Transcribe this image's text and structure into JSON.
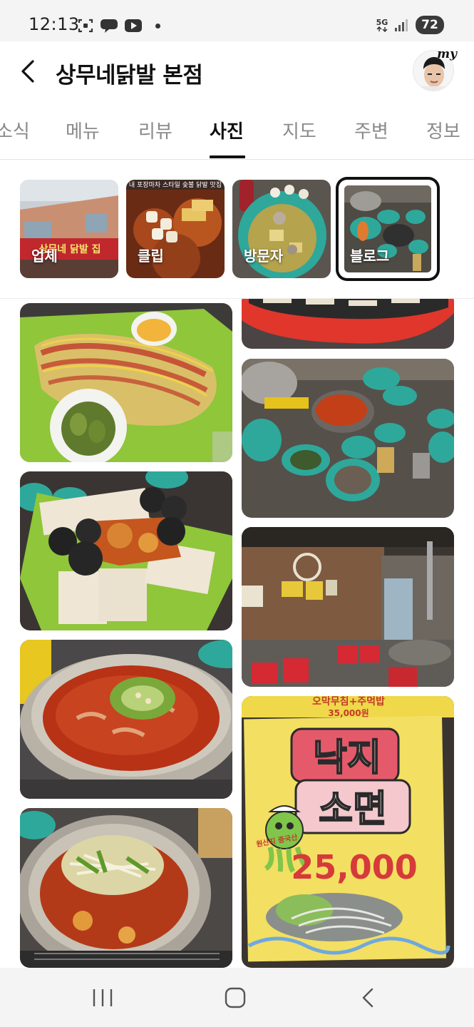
{
  "status_bar": {
    "time": "12:13",
    "network": "5G",
    "battery": "72"
  },
  "header": {
    "title": "상무네닭발 본점",
    "profile_badge": "my"
  },
  "tabs": [
    {
      "label": "소식",
      "active": false
    },
    {
      "label": "메뉴",
      "active": false
    },
    {
      "label": "리뷰",
      "active": false
    },
    {
      "label": "사진",
      "active": true
    },
    {
      "label": "지도",
      "active": false
    },
    {
      "label": "주변",
      "active": false
    },
    {
      "label": "정보",
      "active": false
    }
  ],
  "photo_categories": [
    {
      "label": "업체",
      "selected": false
    },
    {
      "label": "클립",
      "selected": false
    },
    {
      "label": "방문자",
      "selected": false
    },
    {
      "label": "블로그",
      "selected": true
    }
  ],
  "photos": {
    "left_column": [
      "omelette-photo",
      "tofu-platter-photo",
      "spicy-stew-photo",
      "bean-sprout-stew-photo"
    ],
    "right_column": [
      "red-tray-photo",
      "table-spread-photo",
      "restaurant-interior-photo",
      "menu-sign-photo"
    ],
    "sign_text": {
      "top_banner": "오막무침+주먹밥",
      "top_price": "35,000원",
      "name_line1": "낙지",
      "name_line2": "소면",
      "origin": "원산지 중국산",
      "price": "25,000"
    }
  },
  "colors": {
    "accent": "#111111",
    "inactive_tab": "#8a8a8a"
  }
}
